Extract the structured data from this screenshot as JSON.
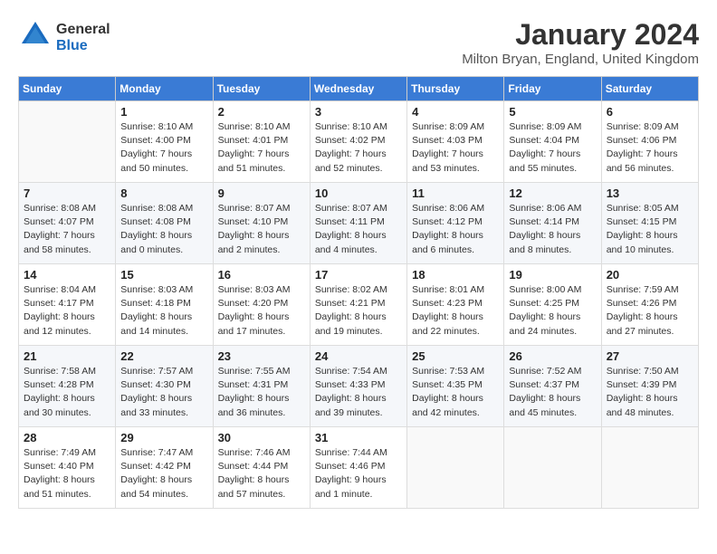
{
  "header": {
    "logo_line1": "General",
    "logo_line2": "Blue",
    "month_title": "January 2024",
    "location": "Milton Bryan, England, United Kingdom"
  },
  "days_of_week": [
    "Sunday",
    "Monday",
    "Tuesday",
    "Wednesday",
    "Thursday",
    "Friday",
    "Saturday"
  ],
  "weeks": [
    [
      {
        "day": "",
        "info": ""
      },
      {
        "day": "1",
        "info": "Sunrise: 8:10 AM\nSunset: 4:00 PM\nDaylight: 7 hours\nand 50 minutes."
      },
      {
        "day": "2",
        "info": "Sunrise: 8:10 AM\nSunset: 4:01 PM\nDaylight: 7 hours\nand 51 minutes."
      },
      {
        "day": "3",
        "info": "Sunrise: 8:10 AM\nSunset: 4:02 PM\nDaylight: 7 hours\nand 52 minutes."
      },
      {
        "day": "4",
        "info": "Sunrise: 8:09 AM\nSunset: 4:03 PM\nDaylight: 7 hours\nand 53 minutes."
      },
      {
        "day": "5",
        "info": "Sunrise: 8:09 AM\nSunset: 4:04 PM\nDaylight: 7 hours\nand 55 minutes."
      },
      {
        "day": "6",
        "info": "Sunrise: 8:09 AM\nSunset: 4:06 PM\nDaylight: 7 hours\nand 56 minutes."
      }
    ],
    [
      {
        "day": "7",
        "info": "Sunrise: 8:08 AM\nSunset: 4:07 PM\nDaylight: 7 hours\nand 58 minutes."
      },
      {
        "day": "8",
        "info": "Sunrise: 8:08 AM\nSunset: 4:08 PM\nDaylight: 8 hours\nand 0 minutes."
      },
      {
        "day": "9",
        "info": "Sunrise: 8:07 AM\nSunset: 4:10 PM\nDaylight: 8 hours\nand 2 minutes."
      },
      {
        "day": "10",
        "info": "Sunrise: 8:07 AM\nSunset: 4:11 PM\nDaylight: 8 hours\nand 4 minutes."
      },
      {
        "day": "11",
        "info": "Sunrise: 8:06 AM\nSunset: 4:12 PM\nDaylight: 8 hours\nand 6 minutes."
      },
      {
        "day": "12",
        "info": "Sunrise: 8:06 AM\nSunset: 4:14 PM\nDaylight: 8 hours\nand 8 minutes."
      },
      {
        "day": "13",
        "info": "Sunrise: 8:05 AM\nSunset: 4:15 PM\nDaylight: 8 hours\nand 10 minutes."
      }
    ],
    [
      {
        "day": "14",
        "info": "Sunrise: 8:04 AM\nSunset: 4:17 PM\nDaylight: 8 hours\nand 12 minutes."
      },
      {
        "day": "15",
        "info": "Sunrise: 8:03 AM\nSunset: 4:18 PM\nDaylight: 8 hours\nand 14 minutes."
      },
      {
        "day": "16",
        "info": "Sunrise: 8:03 AM\nSunset: 4:20 PM\nDaylight: 8 hours\nand 17 minutes."
      },
      {
        "day": "17",
        "info": "Sunrise: 8:02 AM\nSunset: 4:21 PM\nDaylight: 8 hours\nand 19 minutes."
      },
      {
        "day": "18",
        "info": "Sunrise: 8:01 AM\nSunset: 4:23 PM\nDaylight: 8 hours\nand 22 minutes."
      },
      {
        "day": "19",
        "info": "Sunrise: 8:00 AM\nSunset: 4:25 PM\nDaylight: 8 hours\nand 24 minutes."
      },
      {
        "day": "20",
        "info": "Sunrise: 7:59 AM\nSunset: 4:26 PM\nDaylight: 8 hours\nand 27 minutes."
      }
    ],
    [
      {
        "day": "21",
        "info": "Sunrise: 7:58 AM\nSunset: 4:28 PM\nDaylight: 8 hours\nand 30 minutes."
      },
      {
        "day": "22",
        "info": "Sunrise: 7:57 AM\nSunset: 4:30 PM\nDaylight: 8 hours\nand 33 minutes."
      },
      {
        "day": "23",
        "info": "Sunrise: 7:55 AM\nSunset: 4:31 PM\nDaylight: 8 hours\nand 36 minutes."
      },
      {
        "day": "24",
        "info": "Sunrise: 7:54 AM\nSunset: 4:33 PM\nDaylight: 8 hours\nand 39 minutes."
      },
      {
        "day": "25",
        "info": "Sunrise: 7:53 AM\nSunset: 4:35 PM\nDaylight: 8 hours\nand 42 minutes."
      },
      {
        "day": "26",
        "info": "Sunrise: 7:52 AM\nSunset: 4:37 PM\nDaylight: 8 hours\nand 45 minutes."
      },
      {
        "day": "27",
        "info": "Sunrise: 7:50 AM\nSunset: 4:39 PM\nDaylight: 8 hours\nand 48 minutes."
      }
    ],
    [
      {
        "day": "28",
        "info": "Sunrise: 7:49 AM\nSunset: 4:40 PM\nDaylight: 8 hours\nand 51 minutes."
      },
      {
        "day": "29",
        "info": "Sunrise: 7:47 AM\nSunset: 4:42 PM\nDaylight: 8 hours\nand 54 minutes."
      },
      {
        "day": "30",
        "info": "Sunrise: 7:46 AM\nSunset: 4:44 PM\nDaylight: 8 hours\nand 57 minutes."
      },
      {
        "day": "31",
        "info": "Sunrise: 7:44 AM\nSunset: 4:46 PM\nDaylight: 9 hours\nand 1 minute."
      },
      {
        "day": "",
        "info": ""
      },
      {
        "day": "",
        "info": ""
      },
      {
        "day": "",
        "info": ""
      }
    ]
  ]
}
